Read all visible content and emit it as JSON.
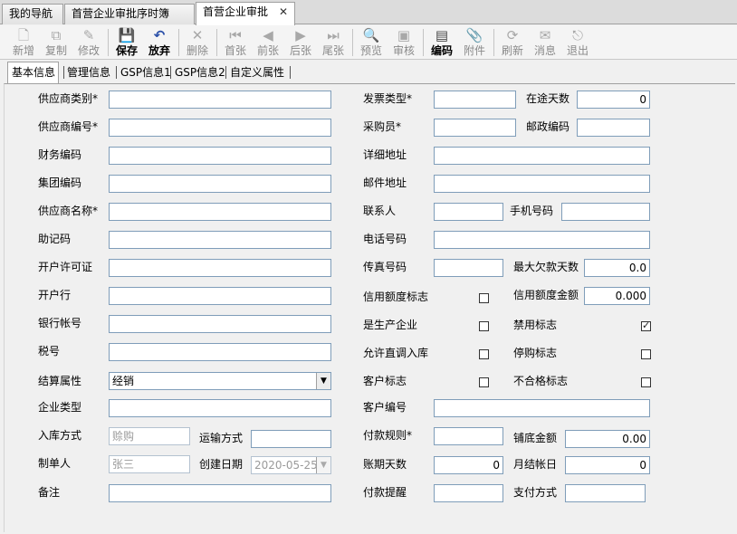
{
  "doc_tabs": [
    {
      "label": "我的导航"
    },
    {
      "label": "首营企业审批序时簿"
    },
    {
      "label": "首营企业审批",
      "close": "✕"
    }
  ],
  "toolbar": [
    {
      "label": "新增",
      "icon": "🗋"
    },
    {
      "label": "复制",
      "icon": "⧉"
    },
    {
      "label": "修改",
      "icon": "✎"
    },
    {
      "label": "保存",
      "icon": "💾"
    },
    {
      "label": "放弃",
      "icon": "↶"
    },
    {
      "label": "删除",
      "icon": "✕"
    },
    {
      "label": "首张",
      "icon": "⏮"
    },
    {
      "label": "前张",
      "icon": "◀"
    },
    {
      "label": "后张",
      "icon": "▶"
    },
    {
      "label": "尾张",
      "icon": "⏭"
    },
    {
      "label": "预览",
      "icon": "🔍"
    },
    {
      "label": "审核",
      "icon": "▣"
    },
    {
      "label": "编码",
      "icon": "▤"
    },
    {
      "label": "附件",
      "icon": "📎"
    },
    {
      "label": "刷新",
      "icon": "⟳"
    },
    {
      "label": "消息",
      "icon": "✉"
    },
    {
      "label": "退出",
      "icon": "⎋"
    }
  ],
  "inner_tabs": [
    {
      "label": "基本信息"
    },
    {
      "label": "管理信息"
    },
    {
      "label": "GSP信息1"
    },
    {
      "label": "GSP信息2"
    },
    {
      "label": "自定义属性"
    }
  ],
  "form": {
    "supplier_type": {
      "label": "供应商类别*",
      "value": ""
    },
    "invoice_type": {
      "label": "发票类型*",
      "value": ""
    },
    "transit_days": {
      "label": "在途天数",
      "value": "0"
    },
    "supplier_code": {
      "label": "供应商编号*",
      "value": ""
    },
    "buyer": {
      "label": "采购员*",
      "value": ""
    },
    "postal_code": {
      "label": "邮政编码",
      "value": ""
    },
    "finance_code": {
      "label": "财务编码",
      "value": ""
    },
    "address": {
      "label": "详细地址",
      "value": ""
    },
    "group_code": {
      "label": "集团编码",
      "value": ""
    },
    "mail_address": {
      "label": "邮件地址",
      "value": ""
    },
    "supplier_name": {
      "label": "供应商名称*",
      "value": ""
    },
    "contact": {
      "label": "联系人",
      "value": ""
    },
    "mobile": {
      "label": "手机号码",
      "value": ""
    },
    "mnemonic": {
      "label": "助记码",
      "value": ""
    },
    "phone": {
      "label": "电话号码",
      "value": ""
    },
    "license": {
      "label": "开户许可证",
      "value": ""
    },
    "fax": {
      "label": "传真号码",
      "value": ""
    },
    "max_overdue_days": {
      "label": "最大欠款天数",
      "value": "0.0"
    },
    "bank": {
      "label": "开户行",
      "value": ""
    },
    "credit_flag": {
      "label": "信用额度标志",
      "checked": false
    },
    "credit_amount": {
      "label": "信用额度金额",
      "value": "0.000"
    },
    "bank_account": {
      "label": "银行帐号",
      "value": ""
    },
    "is_manufacturer": {
      "label": "是生产企业",
      "checked": false
    },
    "disabled_flag": {
      "label": "禁用标志",
      "checked": true
    },
    "tax_no": {
      "label": "税号",
      "value": ""
    },
    "direct_stock_in": {
      "label": "允许直调入库",
      "checked": false
    },
    "stop_purchase": {
      "label": "停购标志",
      "checked": false
    },
    "settlement": {
      "label": "结算属性",
      "value": "经销",
      "arrow": "▼"
    },
    "customer_flag": {
      "label": "客户标志",
      "checked": false
    },
    "unqualified_flag": {
      "label": "不合格标志",
      "checked": false
    },
    "enterprise_type": {
      "label": "企业类型",
      "value": ""
    },
    "customer_code": {
      "label": "客户编号",
      "value": ""
    },
    "stock_in_method": {
      "label": "入库方式",
      "value": "赊购"
    },
    "transport": {
      "label": "运输方式",
      "value": ""
    },
    "payment_rule": {
      "label": "付款规则*",
      "value": ""
    },
    "base_amount": {
      "label": "铺底金额",
      "value": "0.00"
    },
    "creator": {
      "label": "制单人",
      "value": "张三"
    },
    "create_date": {
      "label": "创建日期",
      "value": "2020-05-25",
      "arrow": "▼"
    },
    "account_days": {
      "label": "账期天数",
      "value": "0"
    },
    "monthly_day": {
      "label": "月结帐日",
      "value": "0"
    },
    "remark": {
      "label": "备注",
      "value": ""
    },
    "payment_reminder": {
      "label": "付款提醒",
      "value": ""
    },
    "payment_method": {
      "label": "支付方式",
      "value": ""
    }
  }
}
